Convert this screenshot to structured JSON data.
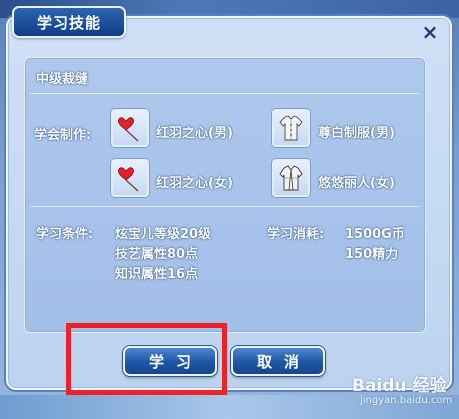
{
  "dialog": {
    "title": "学习技能",
    "close_symbol": "×"
  },
  "skill": {
    "name": "中级裁缝",
    "craft_label": "学会制作:",
    "items": [
      {
        "name": "红羽之心(男)",
        "icon": "red-heart-balloon-icon"
      },
      {
        "name": "尊白制服(男)",
        "icon": "white-uniform-icon"
      },
      {
        "name": "红羽之心(女)",
        "icon": "red-heart-balloon-icon"
      },
      {
        "name": "悠悠丽人(女)",
        "icon": "white-jacket-icon"
      }
    ],
    "conditions_label": "学习条件:",
    "conditions": [
      "炫宝儿等级20级",
      "技艺属性80点",
      "知识属性16点"
    ],
    "cost_label": "学习消耗:",
    "costs": [
      "1500G币",
      "150精力"
    ]
  },
  "buttons": {
    "learn_label": "学习",
    "cancel_label": "取消"
  },
  "watermark": {
    "brand": "Baidu 经验",
    "url": "jingyan.baidu.com"
  },
  "colors": {
    "highlight": "#e8242a",
    "title_bg": "#1a4d98"
  }
}
